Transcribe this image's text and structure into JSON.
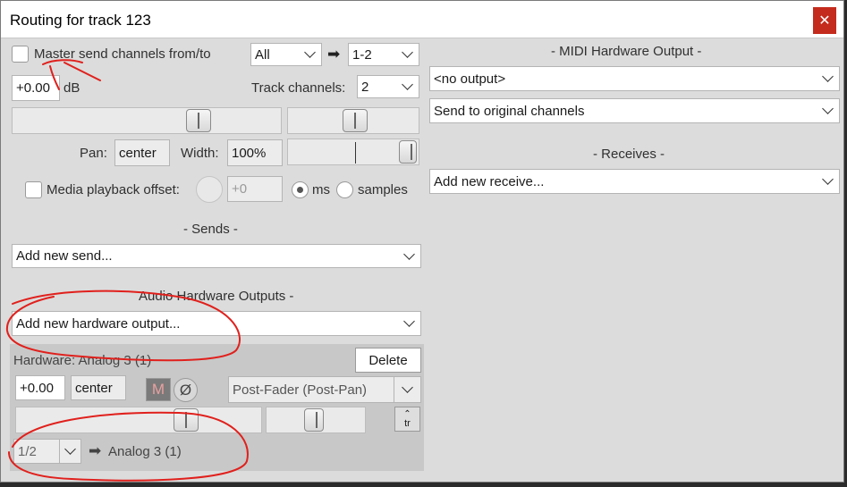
{
  "window": {
    "title": "Routing for track 123",
    "close_glyph": "✕"
  },
  "master": {
    "checkbox_label": "Master send channels from/to",
    "from_value": "All",
    "to_value": "1-2",
    "arrow": "➡",
    "volume_value": "+0.00",
    "volume_unit": "dB",
    "track_channels_label": "Track channels:",
    "track_channels_value": "2",
    "pan_label": "Pan:",
    "pan_value": "center",
    "width_label": "Width:",
    "width_value": "100%",
    "media_offset_label": "Media playback offset:",
    "media_offset_value": "+0",
    "ms_label": "ms",
    "samples_label": "samples"
  },
  "sends": {
    "header": "- Sends -",
    "dropdown": "Add new send..."
  },
  "audio_hw": {
    "header": "Audio Hardware Outputs  -",
    "dropdown": "Add new hardware output...",
    "hw_label": "Hardware: Analog 3 (1)",
    "delete_label": "Delete",
    "volume_value": "+0.00",
    "pan_value": "center",
    "mute_label": "M",
    "phase_label": "Ø",
    "mode_value": "Post-Fader (Post-Pan)",
    "tr_label": "tr",
    "channel_value": "1/2",
    "arrow": "➡",
    "dest_label": "Analog 3 (1)"
  },
  "midi": {
    "header": "-  MIDI Hardware Output  -",
    "output_value": "<no output>",
    "channels_value": "Send to original channels"
  },
  "receives": {
    "header": "-  Receives  -",
    "dropdown": "Add new receive..."
  },
  "colors": {
    "close_red": "#c42b1c",
    "annotation_red": "#e0201c"
  }
}
